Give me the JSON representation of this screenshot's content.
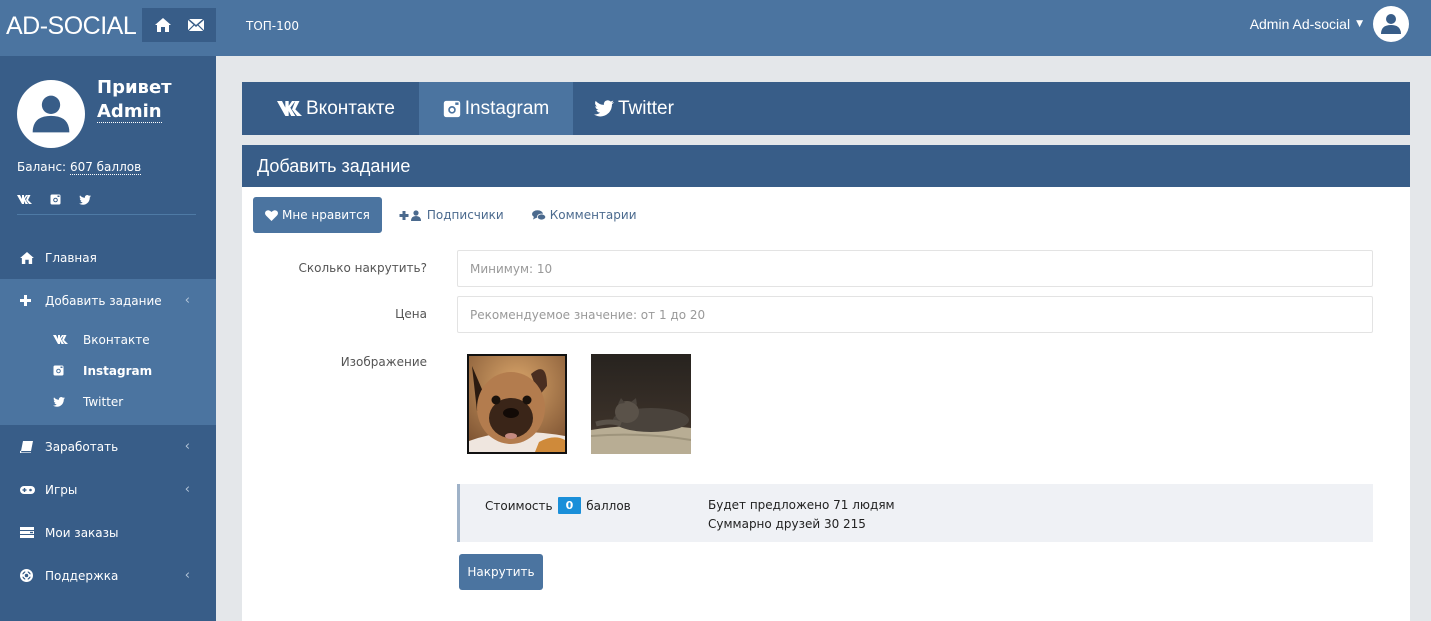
{
  "header": {
    "logo": "AD-SOCIAL",
    "icons": [
      "home-icon",
      "envelope-icon"
    ],
    "top_link": "ТОП-100",
    "user_name": "Admin Ad-social",
    "user_caret": "⌄"
  },
  "sidebar": {
    "greeting": "Привет",
    "name": "Admin",
    "balance_label": "Баланс:",
    "balance_value": "607 баллов",
    "social_icons": [
      "vk-icon",
      "instagram-icon",
      "twitter-icon"
    ],
    "items": [
      {
        "label": "Главная",
        "icon": "home-icon",
        "has_chevron": false
      },
      {
        "label": "Добавить задание",
        "icon": "plus-icon",
        "has_chevron": true,
        "expanded": true,
        "children": [
          {
            "label": "Вконтакте",
            "icon": "vk-icon",
            "active": false
          },
          {
            "label": "Instagram",
            "icon": "instagram-icon",
            "active": true
          },
          {
            "label": "Twitter",
            "icon": "twitter-icon",
            "active": false
          }
        ]
      },
      {
        "label": "Заработать",
        "icon": "book-icon",
        "has_chevron": true
      },
      {
        "label": "Игры",
        "icon": "gamepad-icon",
        "has_chevron": true
      },
      {
        "label": "Мои заказы",
        "icon": "list-icon",
        "has_chevron": false
      },
      {
        "label": "Поддержка",
        "icon": "lifebuoy-icon",
        "has_chevron": true
      }
    ],
    "chevron": "‹"
  },
  "network_tabs": [
    {
      "label": "Вконтакте",
      "icon": "vk-icon",
      "active": false
    },
    {
      "label": "Instagram",
      "icon": "instagram-icon",
      "active": true
    },
    {
      "label": "Twitter",
      "icon": "twitter-icon",
      "active": false
    }
  ],
  "panel": {
    "title": "Добавить задание",
    "task_tabs": [
      {
        "label": "Мне нравится",
        "icon": "heart-icon",
        "active": true
      },
      {
        "label": "Подписчики",
        "icon": "add-user-icon",
        "active": false
      },
      {
        "label": "Комментарии",
        "icon": "comments-icon",
        "active": false
      }
    ],
    "form": {
      "count_label": "Сколько накрутить?",
      "count_value": "",
      "count_placeholder": "Минимум: 10",
      "price_label": "Цена",
      "price_value": "",
      "price_placeholder": "Рекомендуемое значение: от 1 до 20",
      "image_label": "Изображение",
      "images": [
        {
          "subject": "french bulldog photo",
          "selected": true
        },
        {
          "subject": "cat on bed photo",
          "selected": false
        }
      ]
    },
    "summary": {
      "cost_label": "Стоимость",
      "cost_value": "0",
      "cost_unit": "баллов",
      "offered_line": "Будет предложено 71 людям",
      "friends_line": "Суммарно друзей 30 215"
    },
    "submit_label": "Накрутить"
  },
  "colors": {
    "topbar": "#4b74a0",
    "sidebar": "#385d88",
    "accent": "#4b74a0",
    "badge": "#1a8fd9",
    "page_bg": "#e4e7ea"
  }
}
